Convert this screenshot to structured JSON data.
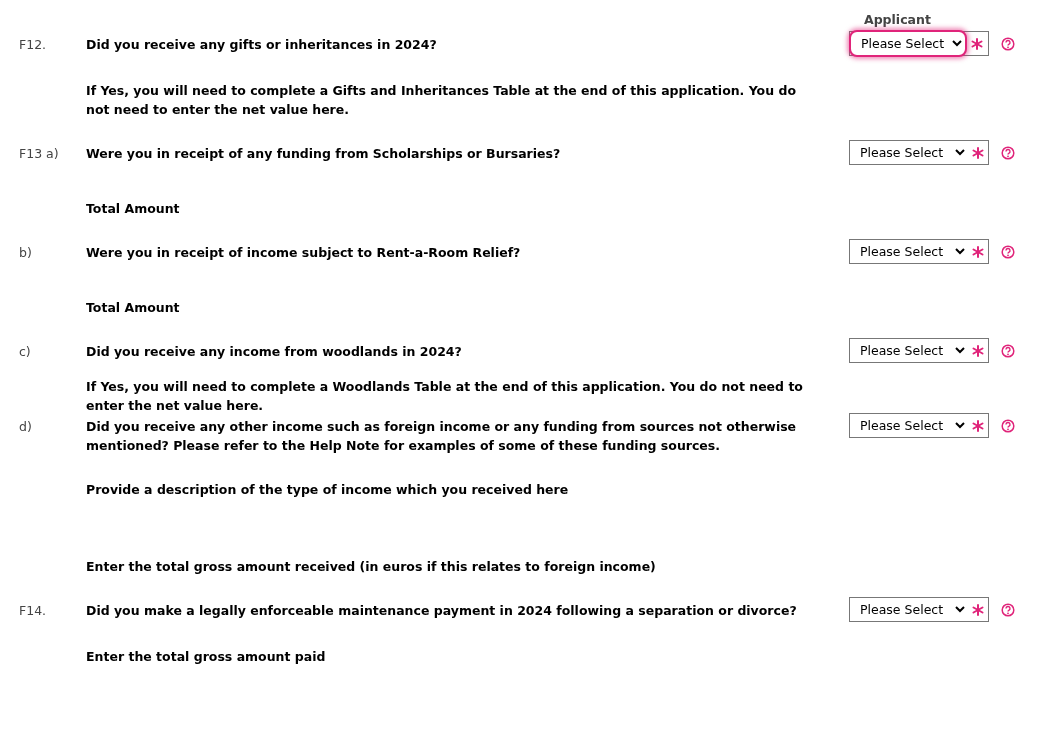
{
  "column_header": "Applicant",
  "items": [
    {
      "kind": "question",
      "label": "F12.",
      "text": "Did you receive any gifts or inheritances in 2024?",
      "select": {
        "value": "Please Select",
        "focused": true
      }
    },
    {
      "kind": "note",
      "text": "If Yes, you will need to complete a Gifts and Inheritances Table at the end of this application. You do not need to enter the net value here."
    },
    {
      "kind": "question",
      "label": "F13 a)",
      "text": "Were you in receipt of any funding from Scholarships or Bursaries?",
      "select": {
        "value": "Please Select",
        "focused": false
      }
    },
    {
      "kind": "amount",
      "text": "Total Amount"
    },
    {
      "kind": "question",
      "label": "b)",
      "text": "Were you in receipt of income subject to Rent-a-Room Relief?",
      "select": {
        "value": "Please Select",
        "focused": false
      }
    },
    {
      "kind": "amount",
      "text": "Total Amount"
    },
    {
      "kind": "question",
      "label": "c)",
      "text": "Did you receive any income from woodlands in 2024?",
      "select": {
        "value": "Please Select",
        "focused": false
      }
    },
    {
      "kind": "tightnote",
      "text": "If Yes, you will need to complete a Woodlands Table at the end of this application. You do not need to enter the net value here."
    },
    {
      "kind": "question",
      "label": "d)",
      "text": "Did you receive any other income such as foreign income or any funding from sources not otherwise mentioned? Please refer to the Help Note for examples of some of these funding sources.",
      "select": {
        "value": "Please Select",
        "focused": false
      }
    },
    {
      "kind": "note",
      "text": "Provide a description of the type of income which you received here"
    },
    {
      "kind": "longamount",
      "text": "Enter the total gross amount received (in euros if this relates to foreign income)"
    },
    {
      "kind": "question",
      "label": "F14.",
      "text": "Did you make a legally enforceable maintenance payment in 2024 following a separation or divorce?",
      "select": {
        "value": "Please Select",
        "focused": false
      }
    },
    {
      "kind": "note",
      "text": "Enter the total gross amount paid"
    }
  ]
}
